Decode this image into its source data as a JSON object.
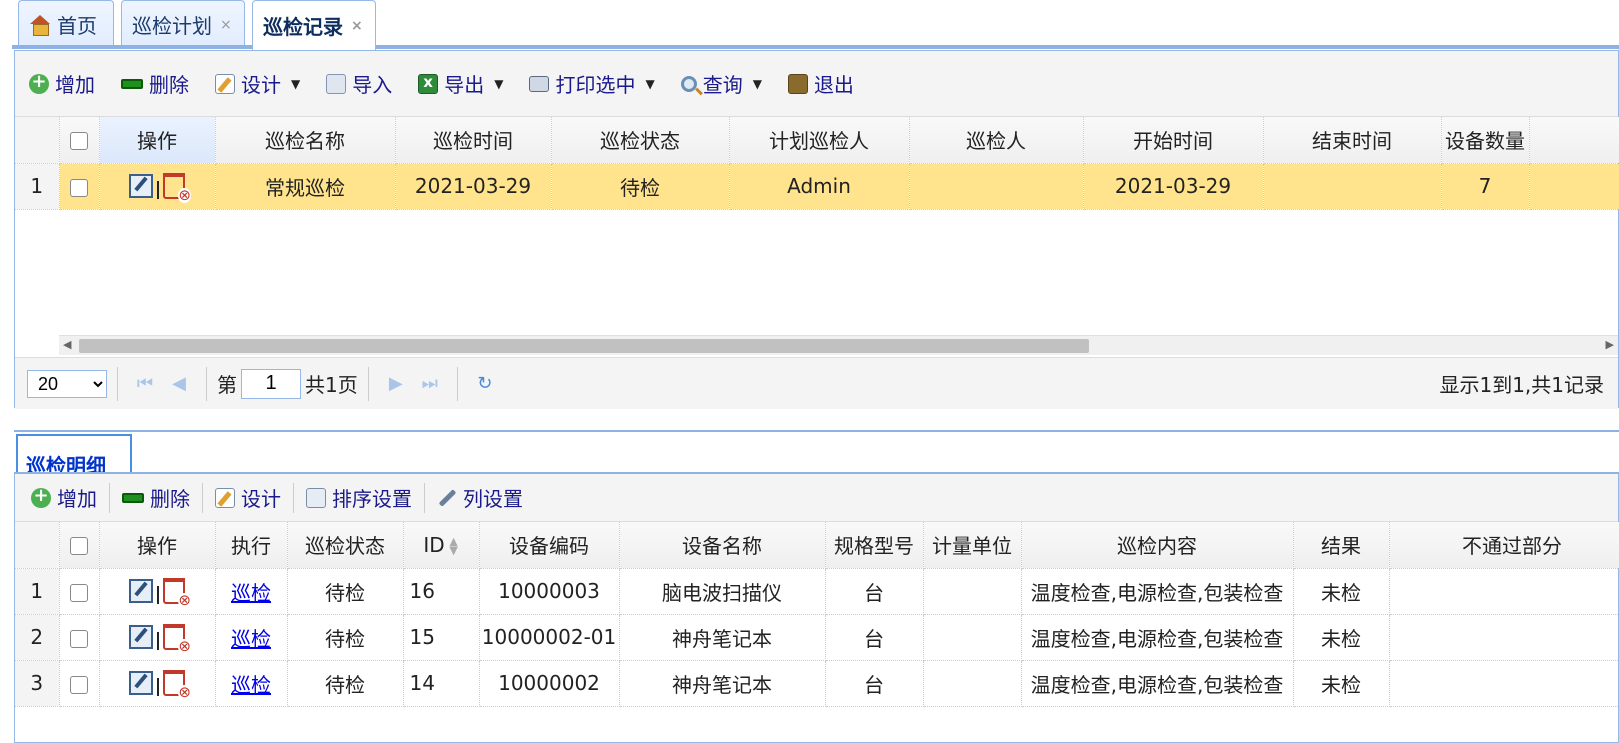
{
  "tabs": [
    {
      "label": "首页"
    },
    {
      "label": "巡检计划",
      "close": "×"
    },
    {
      "label": "巡检记录",
      "close": "×"
    }
  ],
  "toolbar": {
    "add": "增加",
    "delete": "删除",
    "design": "设计",
    "import": "导入",
    "export": "导出",
    "print": "打印选中",
    "query": "查询",
    "exit": "退出"
  },
  "master_grid": {
    "columns": [
      "操作",
      "巡检名称",
      "巡检时间",
      "巡检状态",
      "计划巡检人",
      "巡检人",
      "开始时间",
      "结束时间",
      "设备数量"
    ],
    "rows": [
      {
        "rownum": "1",
        "name": "常规巡检",
        "time": "2021-03-29",
        "status": "待检",
        "planner": "Admin",
        "inspector": "",
        "start": "2021-03-29",
        "end": "",
        "count": "7"
      }
    ]
  },
  "pager": {
    "page_size": "20",
    "page_prefix": "第",
    "page_value": "1",
    "page_suffix": "共1页",
    "info": "显示1到1,共1记录"
  },
  "detail": {
    "tab_label": "巡检明细",
    "toolbar": {
      "add": "增加",
      "delete": "删除",
      "design": "设计",
      "sort": "排序设置",
      "columns": "列设置"
    },
    "columns": [
      "操作",
      "执行",
      "巡检状态",
      "ID",
      "设备编码",
      "设备名称",
      "规格型号",
      "计量单位",
      "巡检内容",
      "结果",
      "不通过部分"
    ],
    "rows": [
      {
        "rownum": "1",
        "exec": "巡检",
        "status": "待检",
        "id": "16",
        "code": "10000003",
        "name": "脑电波扫描仪",
        "spec": "台",
        "unit": "",
        "content": "温度检查,电源检查,包装检查",
        "result": "未检",
        "fail": ""
      },
      {
        "rownum": "2",
        "exec": "巡检",
        "status": "待检",
        "id": "15",
        "code": "10000002-01",
        "name": "神舟笔记本",
        "spec": "台",
        "unit": "",
        "content": "温度检查,电源检查,包装检查",
        "result": "未检",
        "fail": ""
      },
      {
        "rownum": "3",
        "exec": "巡检",
        "status": "待检",
        "id": "14",
        "code": "10000002",
        "name": "神舟笔记本",
        "spec": "台",
        "unit": "",
        "content": "温度检查,电源检查,包装检查",
        "result": "未检",
        "fail": ""
      }
    ]
  }
}
